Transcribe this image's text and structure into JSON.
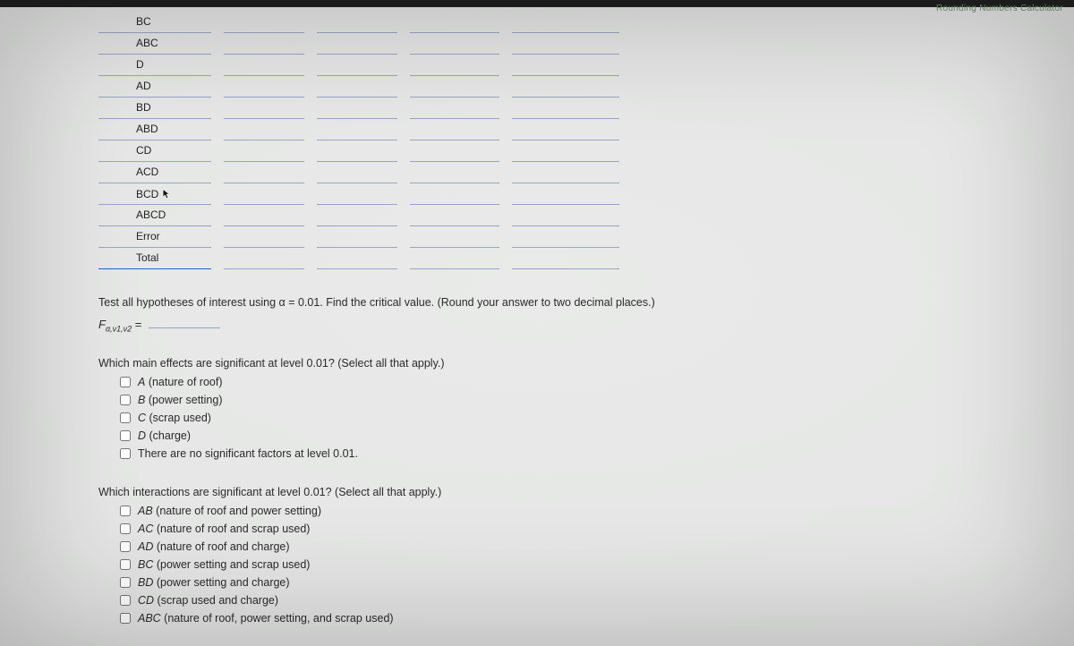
{
  "top_hint": "Rounding Numbers Calculator",
  "table": {
    "rows": [
      "BC",
      "ABC",
      "D",
      "AD",
      "BD",
      "ABD",
      "CD",
      "ACD",
      "BCD",
      "ABCD",
      "Error",
      "Total"
    ],
    "cursor_row_index": 8
  },
  "critical": {
    "prompt": "Test all hypotheses of interest using α = 0.01. Find the critical value. (Round your answer to two decimal places.)",
    "formula_prefix": "F",
    "formula_sub": "α,ν1,ν2",
    "equals": " ="
  },
  "q_main": {
    "head": "Which main effects are significant at level 0.01? (Select all that apply.)",
    "options": [
      {
        "em": "A",
        "rest": " (nature of roof)"
      },
      {
        "em": "B",
        "rest": " (power setting)"
      },
      {
        "em": "C",
        "rest": " (scrap used)"
      },
      {
        "em": "D",
        "rest": " (charge)"
      },
      {
        "em": "",
        "rest": "There are no significant factors at level 0.01."
      }
    ]
  },
  "q_inter": {
    "head": "Which interactions are significant at level 0.01? (Select all that apply.)",
    "options": [
      {
        "em": "AB",
        "rest": " (nature of roof and power setting)"
      },
      {
        "em": "AC",
        "rest": " (nature of roof and scrap used)"
      },
      {
        "em": "AD",
        "rest": " (nature of roof and charge)"
      },
      {
        "em": "BC",
        "rest": " (power setting and scrap used)"
      },
      {
        "em": "BD",
        "rest": " (power setting and charge)"
      },
      {
        "em": "CD",
        "rest": " (scrap used and charge)"
      },
      {
        "em": "ABC",
        "rest": " (nature of roof, power setting, and scrap used)"
      }
    ]
  }
}
